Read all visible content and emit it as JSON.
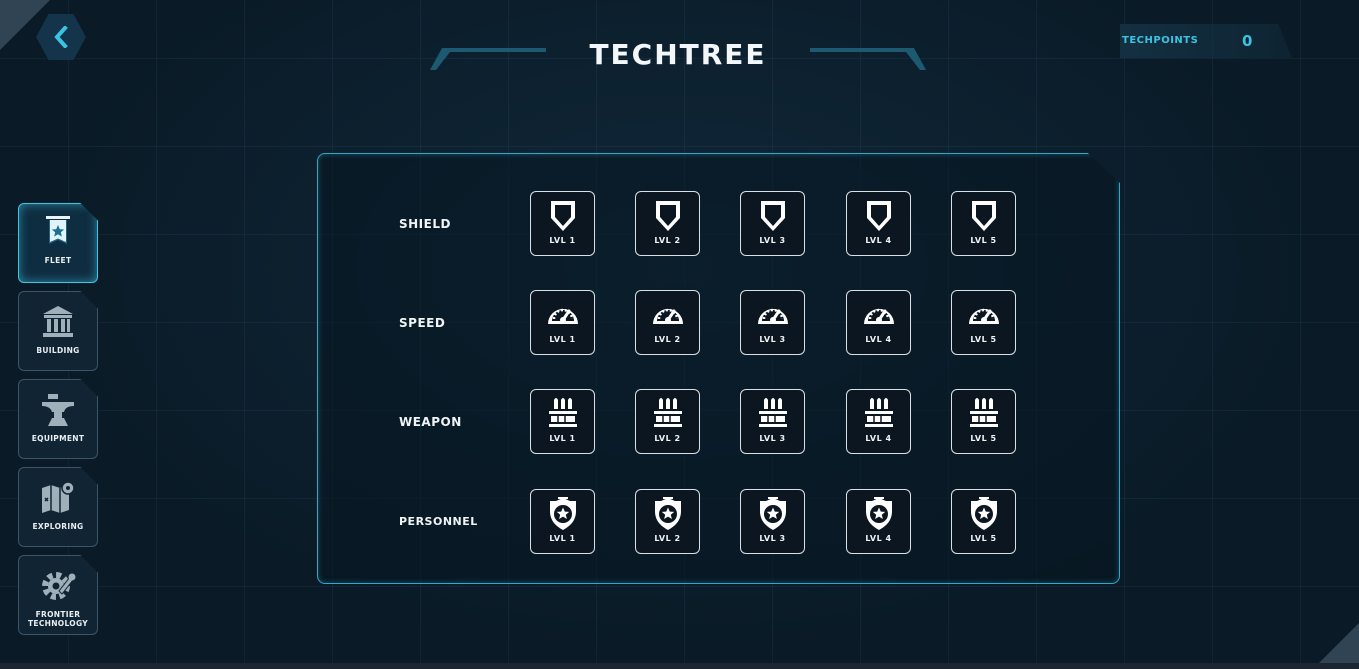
{
  "header": {
    "title": "TECHTREE",
    "techpoints_label": "TECHPOINTS",
    "techpoints_value": "0"
  },
  "sidebar": {
    "items": [
      {
        "label": "FLEET",
        "icon": "fleet-banner-icon",
        "active": true
      },
      {
        "label": "BUILDING",
        "icon": "building-icon",
        "active": false
      },
      {
        "label": "EQUIPMENT",
        "icon": "anvil-icon",
        "active": false
      },
      {
        "label": "EXPLORING",
        "icon": "map-icon",
        "active": false
      },
      {
        "label": "FRONTIER TECHNOLOGY",
        "icon": "gear-wrench-icon",
        "active": false
      }
    ]
  },
  "techtree": {
    "rows": [
      {
        "label": "SHIELD",
        "icon": "shield-icon",
        "levels": [
          "LVL 1",
          "LVL 2",
          "LVL 3",
          "LVL 4",
          "LVL 5"
        ]
      },
      {
        "label": "SPEED",
        "icon": "speedometer-icon",
        "levels": [
          "LVL 1",
          "LVL 2",
          "LVL 3",
          "LVL 4",
          "LVL 5"
        ]
      },
      {
        "label": "WEAPON",
        "icon": "ammo-icon",
        "levels": [
          "LVL 1",
          "LVL 2",
          "LVL 3",
          "LVL 4",
          "LVL 5"
        ]
      },
      {
        "label": "PERSONNEL",
        "icon": "badge-icon",
        "levels": [
          "LVL 1",
          "LVL 2",
          "LVL 3",
          "LVL 4",
          "LVL 5"
        ]
      }
    ]
  },
  "colors": {
    "accent": "#3cc3e2",
    "panel_border": "#2fa8cc",
    "background": "#0a1a26"
  }
}
